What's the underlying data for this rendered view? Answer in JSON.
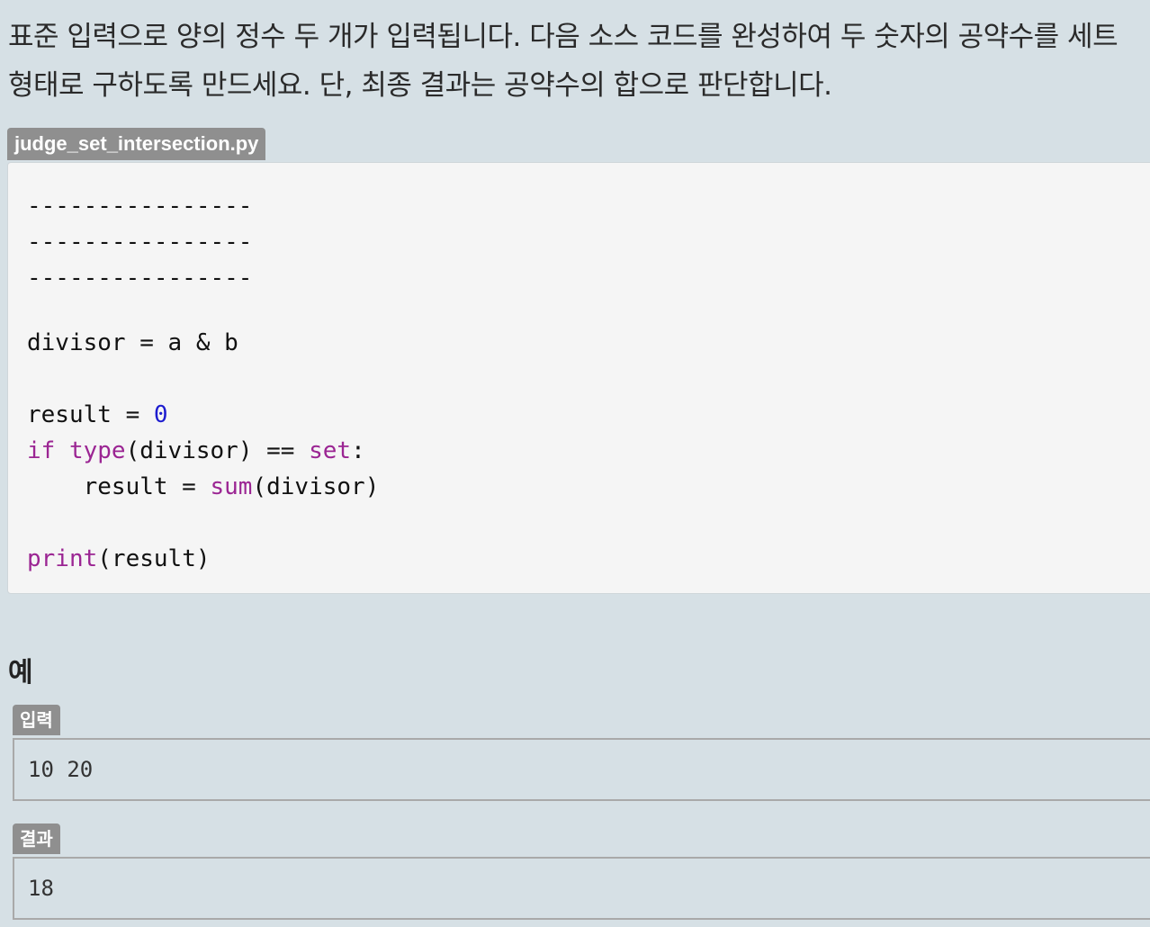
{
  "problem": {
    "line1": "표준 입력으로 양의 정수 두 개가 입력됩니다. 다음 소스 코드를 완성하여 두 숫자의 공약수를 세트",
    "line2": "형태로 구하도록 만드세요. 단, 최종 결과는 공약수의 합으로 판단합니다."
  },
  "file": {
    "name": "judge_set_intersection.py"
  },
  "code": {
    "blank1": "----------------",
    "blank2": "----------------",
    "blank3": "----------------",
    "divisor_line": "divisor = a & b",
    "result_prefix": "result = ",
    "result_zero": "0",
    "if_kw": "if",
    "type_kw": "type",
    "if_middle": "(divisor) == ",
    "set_kw": "set",
    "colon": ":",
    "indent_result": "    result = ",
    "sum_kw": "sum",
    "sum_args": "(divisor)",
    "print_kw": "print",
    "print_args": "(result)"
  },
  "example": {
    "heading": "예",
    "input_label": "입력",
    "input_value": "10 20",
    "output_label": "결과",
    "output_value": "18"
  },
  "colors": {
    "background": "#d6e0e5",
    "code_background": "#f5f5f5",
    "keyword": "#9b2593",
    "number": "#1d1ccf",
    "tag": "#8f8f8f"
  }
}
